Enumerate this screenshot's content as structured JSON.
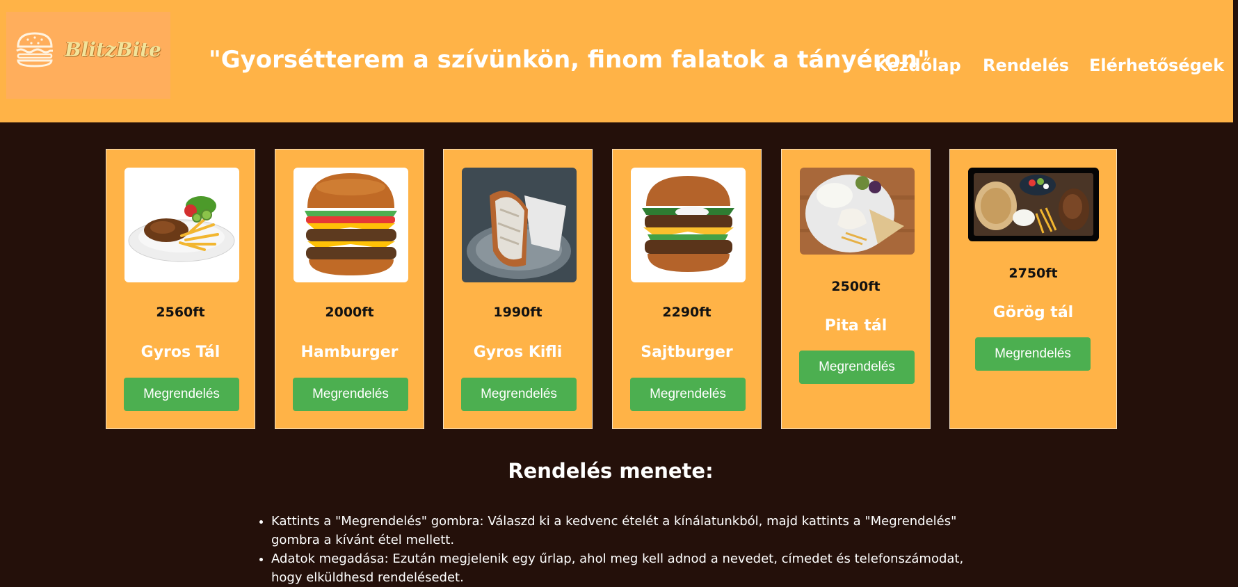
{
  "header": {
    "logo_text": "BlitzBite",
    "slogan": "\"Gyorsétterem a szívünkön, finom falatok a tányéron\"",
    "nav": [
      "Kezdőlap",
      "Rendelés",
      "Elérhetőségek"
    ]
  },
  "menu": [
    {
      "price": "2560ft",
      "name": "Gyros Tál",
      "button": "Megrendelés"
    },
    {
      "price": "2000ft",
      "name": "Hamburger",
      "button": "Megrendelés"
    },
    {
      "price": "1990ft",
      "name": "Gyros Kifli",
      "button": "Megrendelés"
    },
    {
      "price": "2290ft",
      "name": "Sajtburger",
      "button": "Megrendelés"
    },
    {
      "price": "2500ft",
      "name": "Pita tál",
      "button": "Megrendelés"
    },
    {
      "price": "2750ft",
      "name": "Görög tál",
      "button": "Megrendelés"
    }
  ],
  "process": {
    "title": "Rendelés menete:",
    "steps": [
      "Kattints a \"Megrendelés\" gombra: Válaszd ki a kedvenc ételét a kínálatunkból, majd kattints a \"Megrendelés\" gombra a kívánt étel mellett.",
      "Adatok megadása: Ezután megjelenik egy űrlap, ahol meg kell adnod a nevedet, címedet és telefonszámodat, hogy elküldhesd rendelésedet."
    ]
  },
  "colors": {
    "header_bg": "#ffb347",
    "page_bg": "#24100a",
    "button_bg": "#4caf50"
  },
  "icons": [
    "burger-logo-icon"
  ]
}
